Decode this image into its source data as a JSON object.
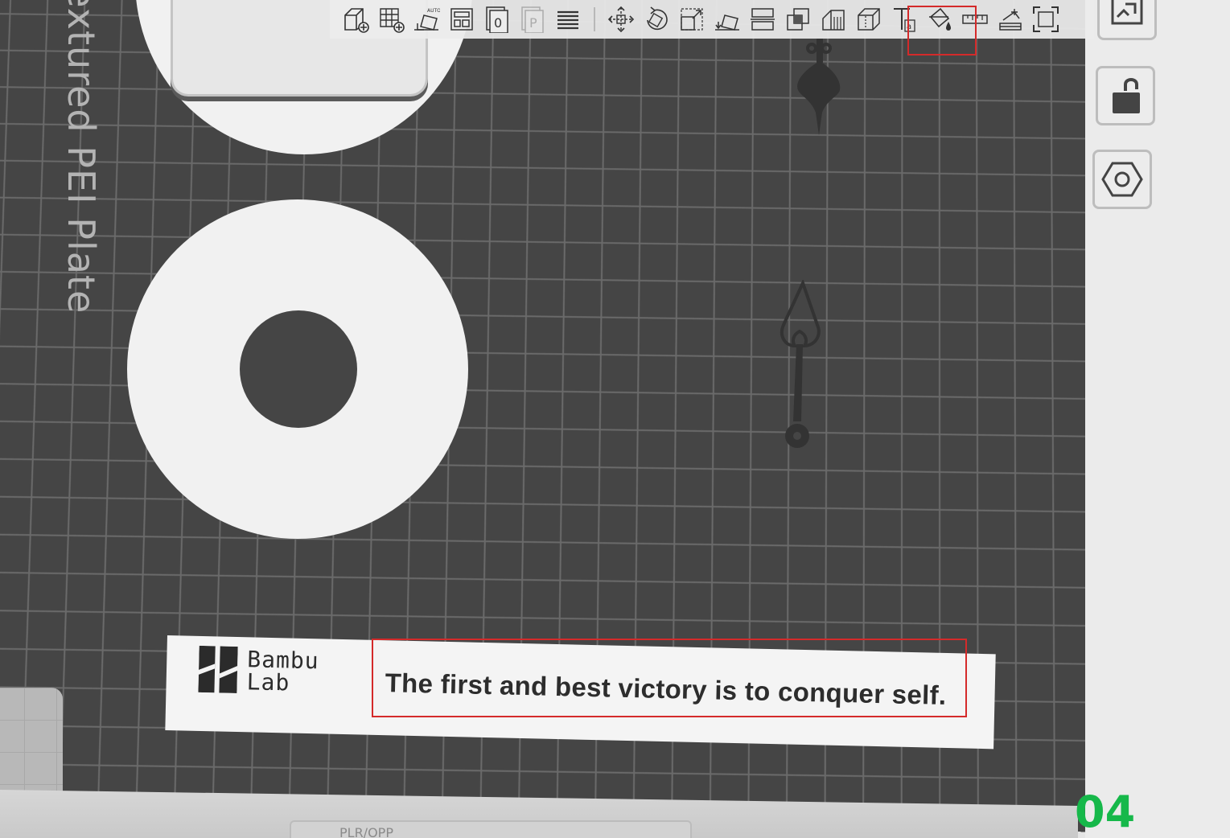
{
  "toolbar": {
    "tools": [
      {
        "id": "add",
        "icon": "add-cube-icon"
      },
      {
        "id": "add-plate",
        "icon": "add-plate-grid-icon"
      },
      {
        "id": "auto-orient",
        "icon": "auto-orient-icon",
        "badge": "AUTO"
      },
      {
        "id": "arrange",
        "icon": "arrange-icon"
      },
      {
        "id": "plate-0",
        "icon": "plate-number-icon",
        "badge": "0"
      },
      {
        "id": "plate-p",
        "icon": "plate-p-icon",
        "badge": "P",
        "disabled": true
      },
      {
        "id": "layers",
        "icon": "layers-icon"
      },
      {
        "id": "move",
        "icon": "move-icon"
      },
      {
        "id": "rotate",
        "icon": "rotate-icon"
      },
      {
        "id": "scale",
        "icon": "scale-icon"
      },
      {
        "id": "lay-on-face",
        "icon": "lay-on-face-icon"
      },
      {
        "id": "cut",
        "icon": "cut-icon"
      },
      {
        "id": "boolean",
        "icon": "boolean-icon"
      },
      {
        "id": "support-paint",
        "icon": "support-paint-icon"
      },
      {
        "id": "seam-paint",
        "icon": "seam-paint-icon"
      },
      {
        "id": "text",
        "icon": "text-tool-icon",
        "badge": "a"
      },
      {
        "id": "color-paint",
        "icon": "color-paint-icon"
      },
      {
        "id": "measure",
        "icon": "measure-icon"
      },
      {
        "id": "assembly",
        "icon": "assembly-icon"
      },
      {
        "id": "fit-view",
        "icon": "fit-view-icon"
      }
    ]
  },
  "plate": {
    "label": "Textured PEI Plate",
    "number": "04",
    "bottom_strip_text": "PLR/OPP"
  },
  "text_plate": {
    "logo_line1": "Bambu",
    "logo_line2": "Lab",
    "message": "The first and best victory is to conquer self."
  },
  "side_panel": {
    "buttons": [
      {
        "id": "arrange-all",
        "icon": "arrange-all-icon"
      },
      {
        "id": "lock",
        "icon": "unlock-icon"
      },
      {
        "id": "plate-settings",
        "icon": "hex-nut-settings-icon"
      }
    ]
  },
  "colors": {
    "plate_background": "#454545",
    "grid_lines": "#6a6a6a",
    "object_white": "#f1f1f1",
    "highlight_red": "#d42a2a",
    "plate_number_green": "#16b84a"
  }
}
